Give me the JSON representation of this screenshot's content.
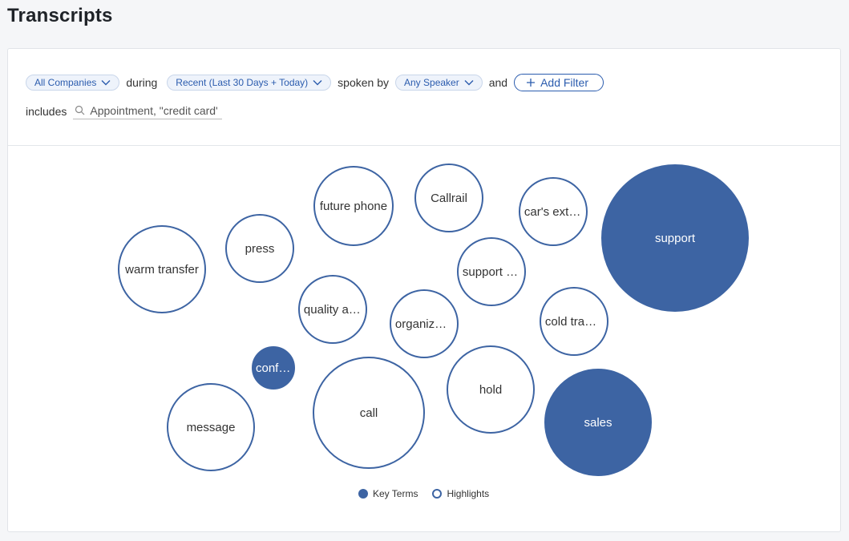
{
  "page": {
    "title": "Transcripts"
  },
  "filters": {
    "company": "All Companies",
    "word_during": "during",
    "period": "Recent (Last 30 Days + Today)",
    "word_spoken_by": "spoken by",
    "speaker": "Any Speaker",
    "word_and": "and",
    "add_filter": "Add Filter",
    "word_includes": "includes",
    "search_placeholder": "Appointment, \"credit card\""
  },
  "colors": {
    "accent": "#3d64a3",
    "link": "#2b5cae",
    "pill_bg": "#eef3fb"
  },
  "bubbles": [
    {
      "label": "warm transfer",
      "type": "highlight"
    },
    {
      "label": "press",
      "type": "highlight"
    },
    {
      "label": "future phone",
      "type": "highlight"
    },
    {
      "label": "Callrail",
      "type": "highlight"
    },
    {
      "label": "car's extended warranty",
      "type": "highlight"
    },
    {
      "label": "support",
      "type": "key"
    },
    {
      "label": "support team",
      "type": "highlight"
    },
    {
      "label": "quality assurance",
      "type": "highlight"
    },
    {
      "label": "organization",
      "type": "highlight"
    },
    {
      "label": "cold transfer",
      "type": "highlight"
    },
    {
      "label": "confirmation",
      "type": "key"
    },
    {
      "label": "message",
      "type": "highlight"
    },
    {
      "label": "call",
      "type": "highlight"
    },
    {
      "label": "hold",
      "type": "highlight"
    },
    {
      "label": "sales",
      "type": "key"
    }
  ],
  "legend": {
    "key_terms": "Key Terms",
    "highlights": "Highlights"
  }
}
